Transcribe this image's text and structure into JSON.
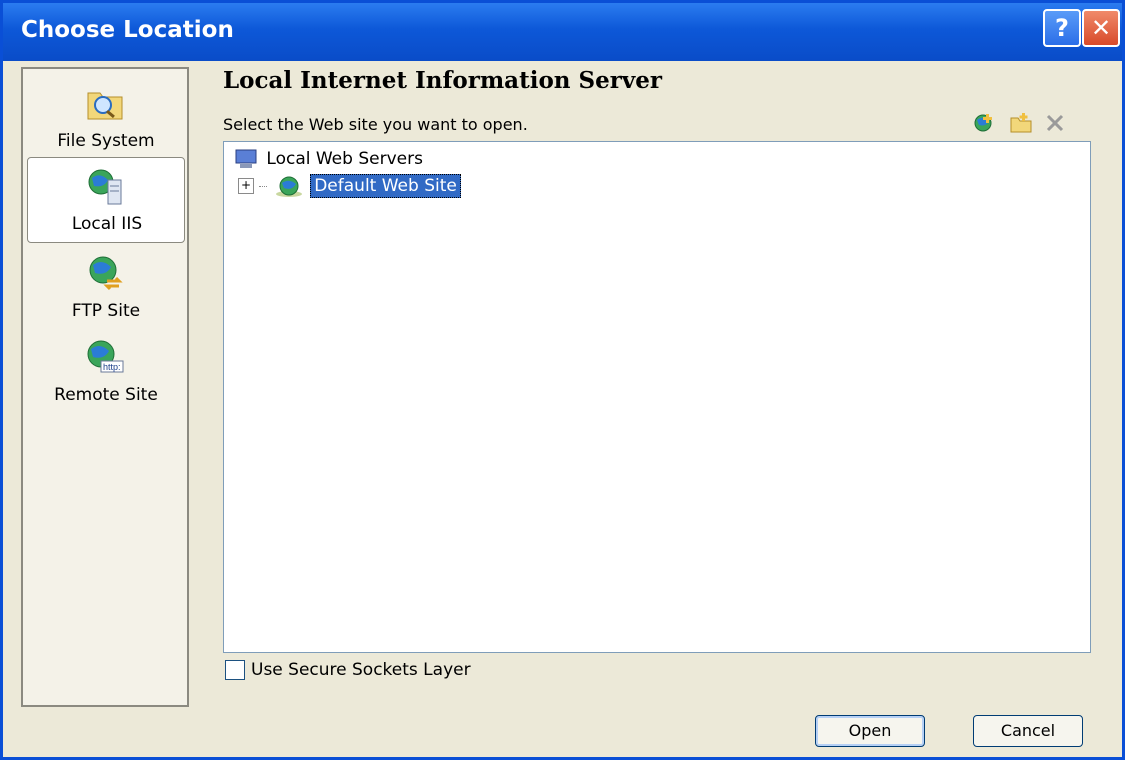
{
  "window": {
    "title": "Choose Location",
    "help_glyph": "?",
    "close_glyph": "✕"
  },
  "locations": [
    {
      "label": "File System",
      "icon": "folder-search-icon"
    },
    {
      "label": "Local IIS",
      "icon": "iis-server-icon",
      "selected": true
    },
    {
      "label": "FTP Site",
      "icon": "ftp-globe-icon"
    },
    {
      "label": "Remote Site",
      "icon": "http-globe-icon"
    }
  ],
  "main": {
    "heading": "Local Internet Information Server",
    "prompt": "Select the Web site you want to open.",
    "toolbar": [
      "create-web-site-icon",
      "create-folder-icon",
      "delete-icon"
    ]
  },
  "tree": {
    "root": "Local Web Servers",
    "child": "Default Web Site",
    "expander": "+"
  },
  "ssl": {
    "label": "Use Secure Sockets Layer",
    "checked": false
  },
  "buttons": {
    "open": "Open",
    "cancel": "Cancel"
  },
  "colors": {
    "titlebar": "#0a4fd6",
    "selection": "#316ac5",
    "panel": "#ece9d8"
  }
}
